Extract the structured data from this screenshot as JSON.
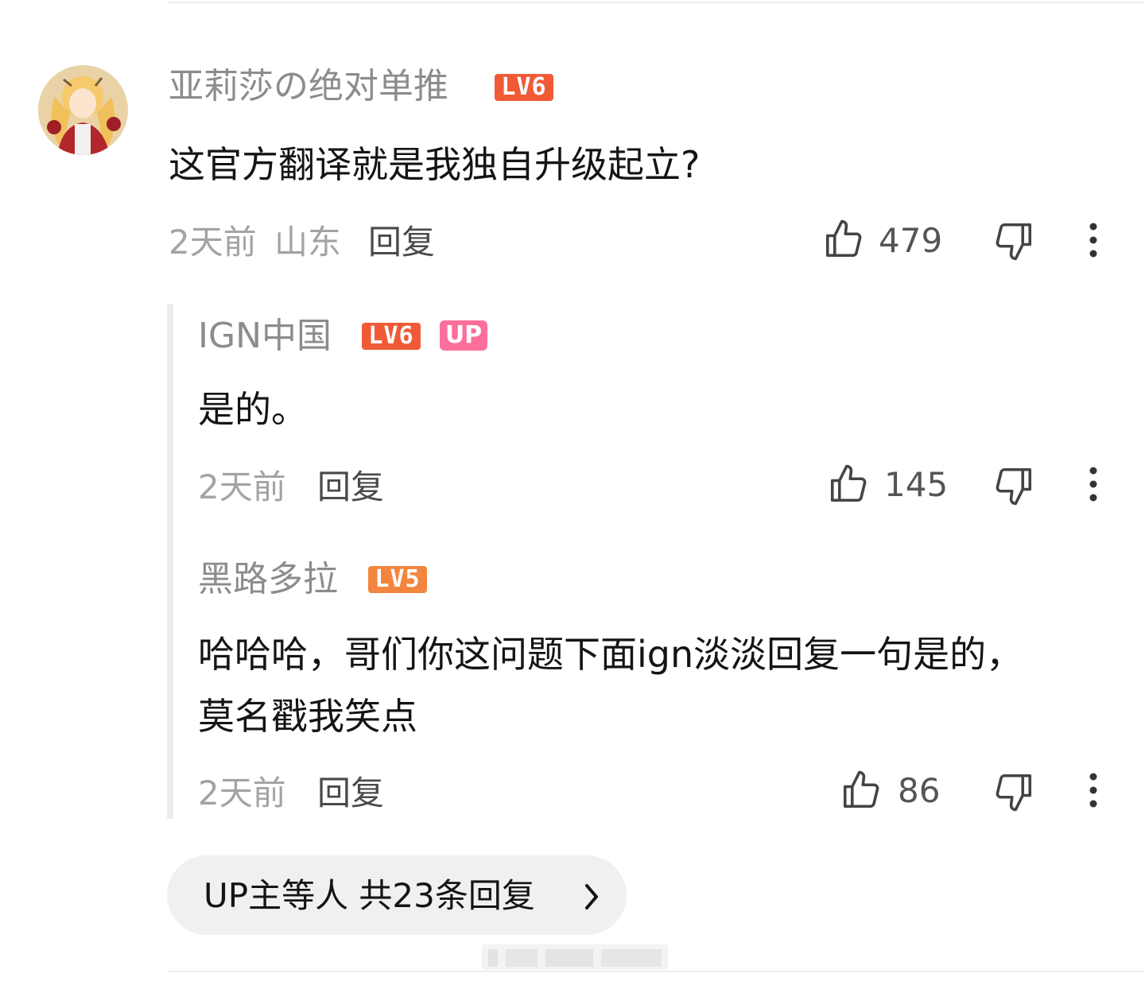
{
  "comment": {
    "username": "亚莉莎の绝对单推",
    "level": "LV6",
    "content": "这官方翻译就是我独自升级起立?",
    "time": "2天前",
    "location": "山东",
    "reply_label": "回复",
    "likes": "479"
  },
  "replies": [
    {
      "username": "IGN中国",
      "level": "LV6",
      "up_badge": "UP",
      "content": "是的。",
      "time": "2天前",
      "reply_label": "回复",
      "likes": "145"
    },
    {
      "username": "黑路多拉",
      "level": "LV5",
      "content": "哈哈哈，哥们你这问题下面ign淡淡回复一句是的，莫名戳我笑点",
      "time": "2天前",
      "reply_label": "回复",
      "likes": "86"
    }
  ],
  "more_replies": {
    "label": "UP主等人 共23条回复"
  },
  "icons": {
    "like": "thumb-up-icon",
    "dislike": "thumb-down-icon",
    "more": "more-vertical-icon",
    "chevron": "chevron-right-icon"
  },
  "colors": {
    "level6": "#f05a36",
    "level5": "#f3863e",
    "up_badge": "#fb6f9b",
    "username": "#8c8c8c",
    "meta": "#a3a3a3"
  }
}
